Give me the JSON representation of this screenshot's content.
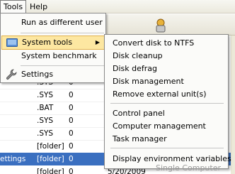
{
  "menubar": {
    "tools": "Tools",
    "help": "Help"
  },
  "tools_menu": {
    "items": [
      {
        "label": "Run as different user"
      },
      {
        "label": "System tools"
      },
      {
        "label": "System benchmark"
      },
      {
        "label": "Settings"
      }
    ]
  },
  "system_tools_submenu": {
    "items": [
      "Convert disk to NTFS",
      "Disk cleanup",
      "Disk defrag",
      "Disk management",
      "Remove external unit(s)",
      "Control panel",
      "Computer management",
      "Task manager",
      "Display environment variables"
    ]
  },
  "file_list": {
    "rows": [
      {
        "c1": "",
        "c2": ".SYS",
        "c3": "0",
        "c4": ""
      },
      {
        "c1": "",
        "c2": ".SYS",
        "c3": "0",
        "c4": ""
      },
      {
        "c1": "",
        "c2": ".BAT",
        "c3": "0",
        "c4": ""
      },
      {
        "c1": "",
        "c2": ".SYS",
        "c3": "0",
        "c4": ""
      },
      {
        "c1": "",
        "c2": ".SYS",
        "c3": "0",
        "c4": ""
      },
      {
        "c1": "",
        "c2": "[folder]",
        "c3": "0",
        "c4": ""
      },
      {
        "c1": "ettings",
        "c2": "[folder]",
        "c3": "0",
        "c4": ""
      },
      {
        "c1": "",
        "c2": "[folder]",
        "c3": "0",
        "c4": "5/20/2009"
      }
    ]
  },
  "watermark": "Single Computer",
  "colors": {
    "highlight": "#fde7a1",
    "selection": "#3a6fc0"
  }
}
